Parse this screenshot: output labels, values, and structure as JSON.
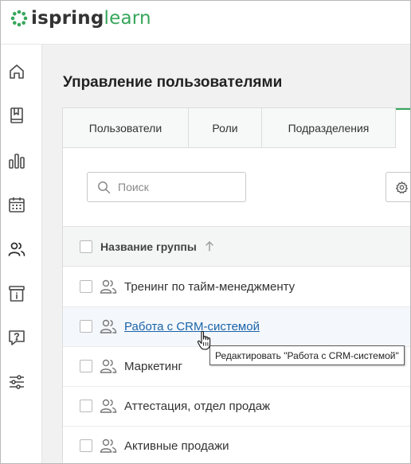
{
  "header": {
    "logo_part1": "ispring",
    "logo_part2": "learn"
  },
  "colors": {
    "brand": "#36a65a",
    "link": "#1a64a8"
  },
  "sidebar": {
    "items": [
      {
        "icon": "home-icon"
      },
      {
        "icon": "book-icon"
      },
      {
        "icon": "bar-chart-icon"
      },
      {
        "icon": "calendar-icon"
      },
      {
        "icon": "users-icon"
      },
      {
        "icon": "info-icon"
      },
      {
        "icon": "help-icon"
      },
      {
        "icon": "sliders-icon"
      }
    ]
  },
  "page": {
    "title": "Управление пользователями"
  },
  "tabs": [
    {
      "label": "Пользователи"
    },
    {
      "label": "Роли"
    },
    {
      "label": "Подразделения"
    }
  ],
  "search": {
    "placeholder": "Поиск",
    "value": ""
  },
  "table": {
    "column_header": "Название группы",
    "rows": [
      {
        "name": "Тренинг по тайм-менеджменту"
      },
      {
        "name": "Работа с CRM-системой"
      },
      {
        "name": "Маркетинг"
      },
      {
        "name": "Аттестация, отдел продаж"
      },
      {
        "name": "Активные продажи"
      }
    ]
  },
  "tooltip": {
    "text": "Редактировать \"Работа с CRM-системой\""
  }
}
